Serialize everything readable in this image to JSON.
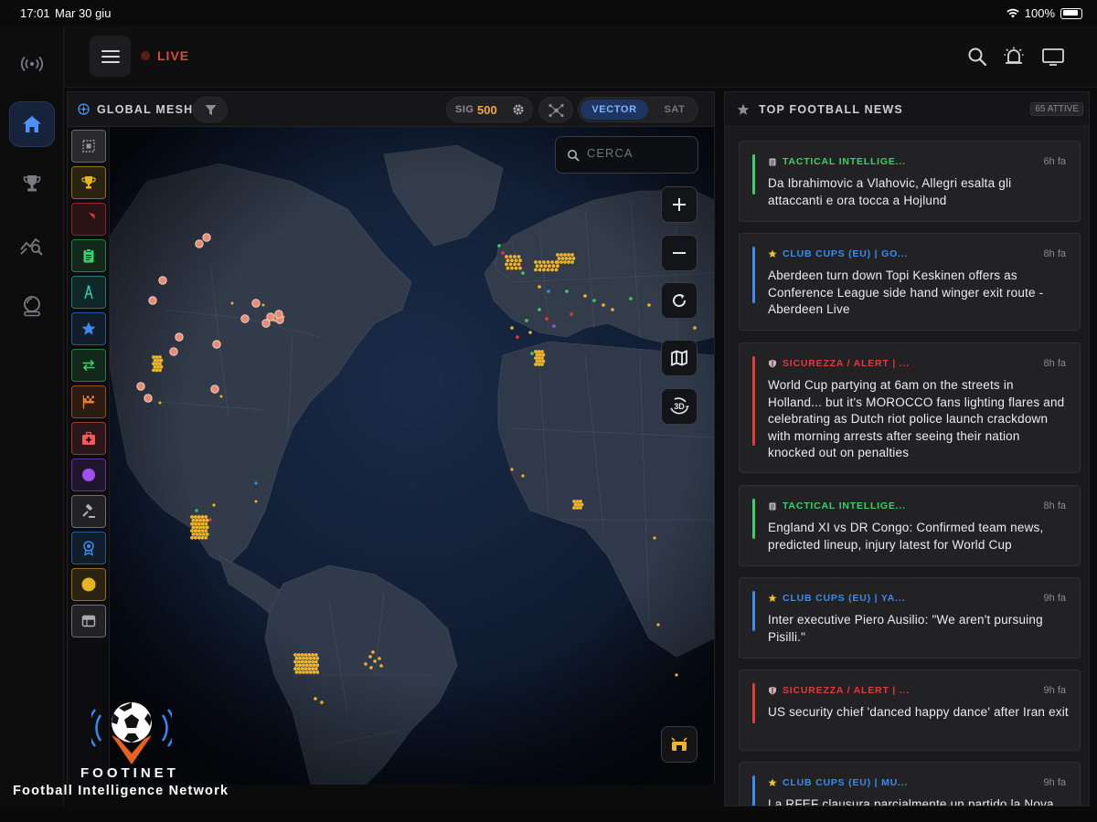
{
  "status_bar": {
    "time": "17:01",
    "date": "Mar 30 giu",
    "battery": "100%"
  },
  "rail": {
    "items": [
      {
        "name": "broadcast-icon"
      },
      {
        "name": "home-icon",
        "active": true
      },
      {
        "name": "trophy-icon"
      },
      {
        "name": "analytics-icon"
      },
      {
        "name": "crystal-ball-icon"
      }
    ]
  },
  "topbar": {
    "live_label": "LIVE"
  },
  "map": {
    "title": "GLOBAL MESH",
    "sig_label": "SIG",
    "sig_value": "500",
    "view_vector": "VECTOR",
    "view_sat": "SAT",
    "search_placeholder": "CERCA",
    "controls": [
      "zoom-in",
      "zoom-out",
      "refresh",
      "map",
      "3d"
    ],
    "control_3d_label": "3D",
    "layers": [
      {
        "name": "select-all",
        "color": "#9a9aa0"
      },
      {
        "name": "trophy",
        "color": "#e6b422"
      },
      {
        "name": "shield",
        "color": "#e23b3b"
      },
      {
        "name": "clipboard",
        "color": "#3ad16a"
      },
      {
        "name": "compass",
        "color": "#2fc8b8"
      },
      {
        "name": "star",
        "color": "#3a8cf0"
      },
      {
        "name": "transfer",
        "color": "#3ad16a"
      },
      {
        "name": "flag",
        "color": "#f07a2a"
      },
      {
        "name": "medical",
        "color": "#f05a5a"
      },
      {
        "name": "globe",
        "color": "#a050f0"
      },
      {
        "name": "gavel",
        "color": "#b0b0b5"
      },
      {
        "name": "award",
        "color": "#3a8cf0"
      },
      {
        "name": "money",
        "color": "#e6b422"
      },
      {
        "name": "table",
        "color": "#b0b0b5"
      }
    ]
  },
  "news": {
    "title": "TOP FOOTBALL NEWS",
    "active_badge": "65 ATTIVE",
    "items": [
      {
        "category": "TACTICAL INTELLIGE...",
        "color": "#3ad16a",
        "icon": "clipboard-icon",
        "time": "6h fa",
        "headline": "Da Ibrahimovic a Vlahovic, Allegri esalta gli attaccanti e ora tocca a Hojlund"
      },
      {
        "category": "CLUB CUPS (EU) | GO...",
        "color": "#3a8cf0",
        "icon": "star-icon",
        "time": "8h fa",
        "headline": "Aberdeen turn down Topi Keskinen offers as Conference League side hand winger exit route - Aberdeen Live"
      },
      {
        "category": "SICUREZZA / ALERT | ...",
        "color": "#e23b3b",
        "icon": "shield-icon",
        "time": "8h fa",
        "headline": "World Cup partying at 6am on the streets in Holland... but it's MOROCCO fans lighting flares and celebrating as Dutch riot police launch crackdown with morning arrests after seeing their nation knocked out on penalties"
      },
      {
        "category": "TACTICAL INTELLIGE...",
        "color": "#3ad16a",
        "icon": "clipboard-icon",
        "time": "8h fa",
        "headline": "England XI vs DR Congo: Confirmed team news, predicted lineup, injury latest for World Cup"
      },
      {
        "category": "CLUB CUPS (EU) | YA...",
        "color": "#3a8cf0",
        "icon": "star-icon",
        "time": "9h fa",
        "headline": "Inter executive Piero Ausilio: \"We aren't pursuing Pisilli.\""
      },
      {
        "category": "SICUREZZA / ALERT | ...",
        "color": "#e23b3b",
        "icon": "shield-icon",
        "time": "9h fa",
        "headline": "US security chief 'danced happy dance' after Iran exit"
      },
      {
        "category": "CLUB CUPS (EU) | MU...",
        "color": "#3a8cf0",
        "icon": "star-icon",
        "time": "9h fa",
        "headline": "La RFEF clausura parcialmente un partido la Nova"
      }
    ]
  },
  "logo": {
    "name": "FOOTINET",
    "tagline": "Football Intelligence Network"
  }
}
